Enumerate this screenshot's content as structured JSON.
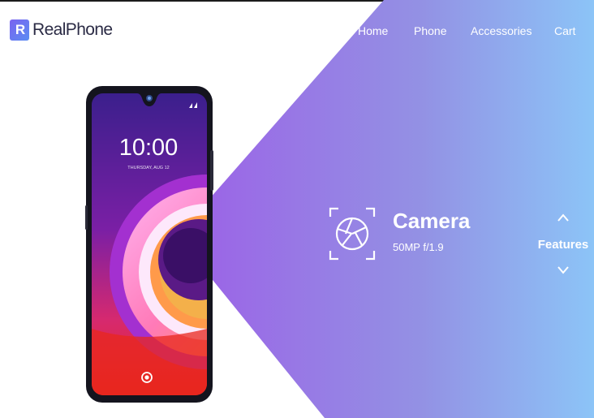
{
  "brand": {
    "logo_mark": "R",
    "name": "RealPhone"
  },
  "nav": {
    "items": [
      "Home",
      "Phone",
      "Accessories",
      "Cart"
    ]
  },
  "phone_screen": {
    "time": "10:00",
    "date": "THURSDAY, AUG 12"
  },
  "feature": {
    "icon": "camera-aperture-icon",
    "title": "Camera",
    "spec": "50MP f/1.9"
  },
  "features_nav": {
    "label": "Features",
    "up_icon": "chevron-up-icon",
    "down_icon": "chevron-down-icon"
  },
  "colors": {
    "gradient_start": "#8f6ee8",
    "gradient_end": "#8cc4f7",
    "brand_text": "#2b2b45",
    "background": "#ffffff"
  }
}
